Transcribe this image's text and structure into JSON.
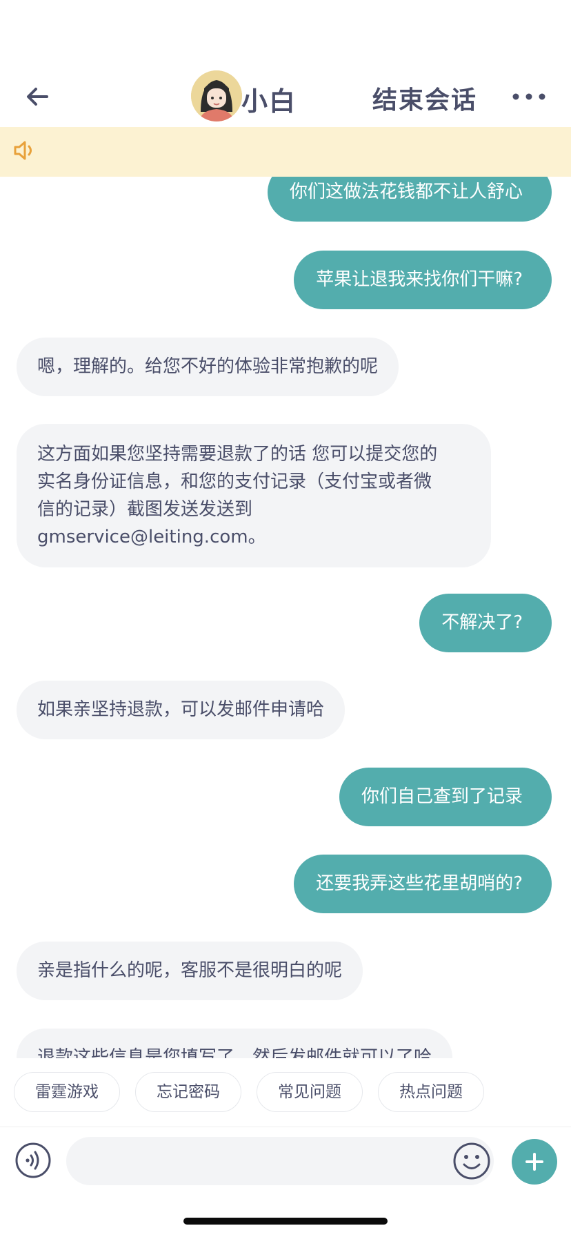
{
  "header": {
    "back_icon": "arrow-left-icon",
    "agent_name": "小白",
    "end_session_label": "结束会话",
    "more_icon": "more-dots-icon"
  },
  "notice": {
    "icon": "speaker-icon",
    "text": ""
  },
  "messages": [
    {
      "side": "out",
      "text": "你们这做法花钱都不让人舒心"
    },
    {
      "side": "out",
      "text": "苹果让退我来找你们干嘛?"
    },
    {
      "side": "in",
      "text": "嗯，理解的。给您不好的体验非常抱歉的呢"
    },
    {
      "side": "in",
      "lines": [
        "这方面如果您坚持需要退款了的话 您可以提交您的",
        "实名身份证信息，和您的支付记录（支付宝或者微",
        "信的记录）截图发送发送到",
        "gmservice@leiting.com。"
      ]
    },
    {
      "side": "out",
      "text": "不解决了?"
    },
    {
      "side": "in",
      "text": "如果亲坚持退款，可以发邮件申请哈"
    },
    {
      "side": "out",
      "text": "你们自己查到了记录"
    },
    {
      "side": "out",
      "text": "还要我弄这些花里胡哨的?"
    },
    {
      "side": "in",
      "text": "亲是指什么的呢，客服不是很明白的呢"
    },
    {
      "side": "in",
      "text": "退款这些信息是您填写了，然后发邮件就可以了哈"
    }
  ],
  "quick_replies": [
    "雷霆游戏",
    "忘记密码",
    "常见问题",
    "热点问题"
  ],
  "composer": {
    "voice_icon": "voice-input-icon",
    "placeholder": "",
    "emoji_icon": "emoji-icon",
    "plus_icon": "plus-icon"
  },
  "colors": {
    "accent": "#53adad",
    "notice_bg": "#fcf2d2",
    "speaker_icon": "#e8a13a",
    "text": "#4a4e69",
    "incoming_bubble": "#f3f4f6"
  }
}
